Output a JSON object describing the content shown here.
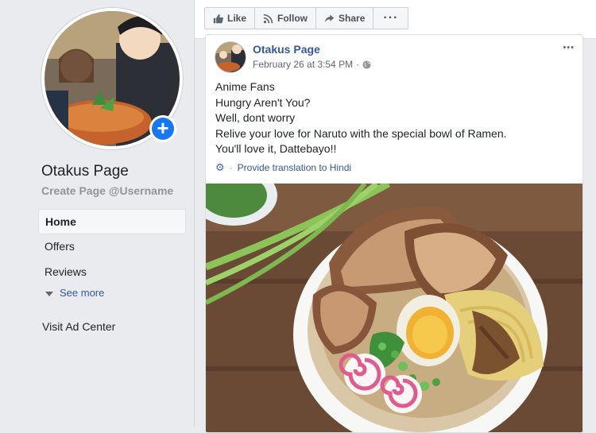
{
  "sidebar": {
    "page_name": "Otakus Page",
    "username": "Create Page @Username",
    "nav": [
      "Home",
      "Offers",
      "Reviews"
    ],
    "see_more": "See more",
    "visit_ad_center": "Visit Ad Center"
  },
  "toolbar": {
    "like": "Like",
    "follow": "Follow",
    "share": "Share",
    "more": "···"
  },
  "post": {
    "author": "Otakus Page",
    "timestamp": "February 26 at 3:54 PM",
    "separator": "·",
    "menu": "•••",
    "lines": [
      "Anime Fans",
      "Hungry Aren't You?",
      "Well, dont worry",
      "Relive your love for Naruto with the special bowl of Ramen.",
      "You'll love it, Dattebayo!!"
    ],
    "translate": "Provide translation to Hindi"
  },
  "colors": {
    "link": "#365899",
    "accent": "#1877f2",
    "background": "#e9ebee"
  },
  "icons": [
    "thumbs-up-icon",
    "rss-follow-icon",
    "share-arrow-icon",
    "ellipsis-icon",
    "globe-icon",
    "gear-icon",
    "plus-icon",
    "caret-down-icon"
  ]
}
